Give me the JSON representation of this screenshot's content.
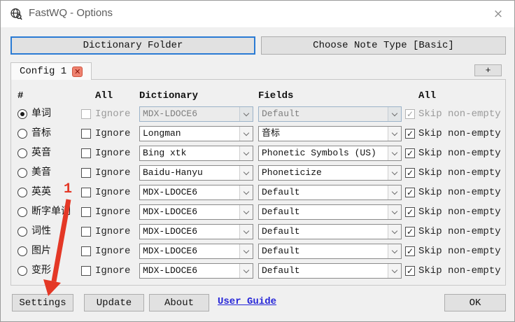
{
  "window": {
    "title": "FastWQ - Options",
    "close_glyph": "×"
  },
  "toolbar": {
    "dictionary_folder": "Dictionary Folder",
    "choose_note_type": "Choose Note Type [Basic]"
  },
  "tabs": {
    "config_tab": "Config 1",
    "tab_close_glyph": "✕",
    "add_tab": "+"
  },
  "table": {
    "headers": {
      "hash": "#",
      "all_left": "All",
      "dictionary": "Dictionary",
      "fields": "Fields",
      "all_right": "All"
    },
    "all_left_checked": false,
    "all_right_checked": true,
    "ignore_label": "Ignore",
    "skip_label": "Skip non-empty",
    "rows": [
      {
        "label": "单词",
        "selected": true,
        "disabled": true,
        "ignore_checked": false,
        "dictionary": "MDX-LDOCE6",
        "fields": "Default",
        "skip_checked": true
      },
      {
        "label": "音标",
        "selected": false,
        "disabled": false,
        "ignore_checked": false,
        "dictionary": "Longman",
        "fields": "音标",
        "skip_checked": true
      },
      {
        "label": "英音",
        "selected": false,
        "disabled": false,
        "ignore_checked": false,
        "dictionary": "Bing xtk",
        "fields": "Phonetic Symbols (US)",
        "skip_checked": true
      },
      {
        "label": "美音",
        "selected": false,
        "disabled": false,
        "ignore_checked": false,
        "dictionary": "Baidu-Hanyu",
        "fields": "Phoneticize",
        "skip_checked": true
      },
      {
        "label": "英英",
        "selected": false,
        "disabled": false,
        "ignore_checked": false,
        "dictionary": "MDX-LDOCE6",
        "fields": "Default",
        "skip_checked": true
      },
      {
        "label": "断字单词",
        "selected": false,
        "disabled": false,
        "ignore_checked": false,
        "dictionary": "MDX-LDOCE6",
        "fields": "Default",
        "skip_checked": true
      },
      {
        "label": "词性",
        "selected": false,
        "disabled": false,
        "ignore_checked": false,
        "dictionary": "MDX-LDOCE6",
        "fields": "Default",
        "skip_checked": true
      },
      {
        "label": "图片",
        "selected": false,
        "disabled": false,
        "ignore_checked": false,
        "dictionary": "MDX-LDOCE6",
        "fields": "Default",
        "skip_checked": true
      },
      {
        "label": "变形",
        "selected": false,
        "disabled": false,
        "ignore_checked": false,
        "dictionary": "MDX-LDOCE6",
        "fields": "Default",
        "skip_checked": true
      }
    ]
  },
  "footer": {
    "settings": "Settings",
    "update": "Update",
    "about": "About",
    "user_guide": "User Guide",
    "ok": "OK"
  },
  "annotation": {
    "number": "1"
  },
  "colors": {
    "focus_border": "#2a7bd4",
    "annotation_red": "#e43826",
    "link_blue": "#2626d8",
    "tab_close_red": "#ee8270"
  }
}
